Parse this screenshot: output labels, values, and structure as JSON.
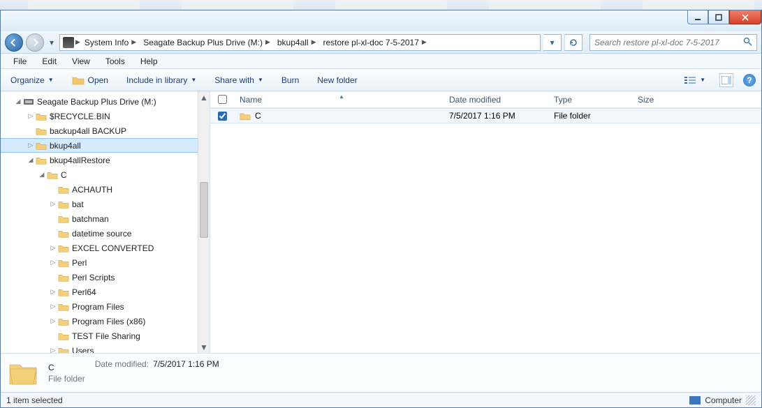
{
  "breadcrumbs": [
    "System Info",
    "Seagate Backup Plus Drive (M:)",
    "bkup4all",
    "restore pl-xl-doc 7-5-2017"
  ],
  "search_placeholder": "Search restore pl-xl-doc 7-5-2017",
  "menubar": {
    "file": "File",
    "edit": "Edit",
    "view": "View",
    "tools": "Tools",
    "help": "Help"
  },
  "toolbar": {
    "organize": "Organize",
    "open": "Open",
    "include": "Include in library",
    "share": "Share with",
    "burn": "Burn",
    "newfolder": "New folder"
  },
  "columns": {
    "name": "Name",
    "date": "Date modified",
    "type": "Type",
    "size": "Size"
  },
  "tree": {
    "drive": "Seagate Backup Plus Drive (M:)",
    "items": [
      "$RECYCLE.BIN",
      "backup4all BACKUP",
      "bkup4all",
      "bkup4allRestore",
      "C",
      "ACHAUTH",
      "bat",
      "batchman",
      "datetime source",
      "EXCEL CONVERTED",
      "Perl",
      "Perl Scripts",
      "Perl64",
      "Program Files",
      "Program Files (x86)",
      "TEST File Sharing",
      "Users"
    ]
  },
  "row": {
    "name": "C",
    "date": "7/5/2017 1:16 PM",
    "type": "File folder",
    "size": ""
  },
  "details": {
    "name": "C",
    "type": "File folder",
    "mod_label": "Date modified:",
    "mod_value": "7/5/2017 1:16 PM"
  },
  "status": {
    "left": "1 item selected",
    "right": "Computer"
  }
}
